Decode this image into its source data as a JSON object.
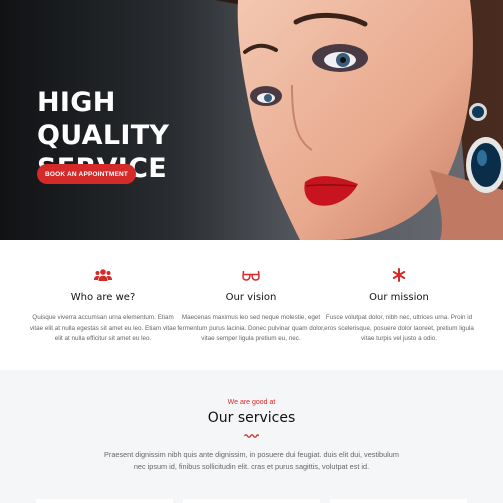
{
  "hero": {
    "title_line1": "HIGH QUALITY",
    "title_line2": "SERVICE",
    "cta_label": "BOOK AN APPOINTMENT"
  },
  "features": [
    {
      "icon": "users-icon",
      "title": "Who are we?",
      "text": "Quisque viverra accumsan urna elementum. Etiam vitae elit at nulla egestas sit amet eu leo. Etiam vitae elit at nulla efficitur sit amet eu leo."
    },
    {
      "icon": "glasses-icon",
      "title": "Our vision",
      "text": "Maecenas maximus leo sed neque molestie, eget fermentum purus lacinia. Donec pulvinar quam dolor, vitae semper ligula pretium eu, nec."
    },
    {
      "icon": "asterisk-icon",
      "title": "Our mission",
      "text": "Fusce volutpat dolor, nibh nec, ultrices urna. Proin id eros scelerisque, posuere dolor laoreet, pretium ligula vitae turpis vel justo a odio."
    }
  ],
  "services": {
    "kicker": "We are good at",
    "title": "Our services",
    "description": "Praesent dignissim nibh quis ante dignissim, in posuere dui feugiat. duis elit dui, vestibulum nec ipsum id, finibus sollicitudin elit. cras et purus sagittis, volutpat est id."
  },
  "colors": {
    "accent": "#d42a2a",
    "hero_dark": "#101214",
    "services_bg": "#f5f6f8"
  }
}
